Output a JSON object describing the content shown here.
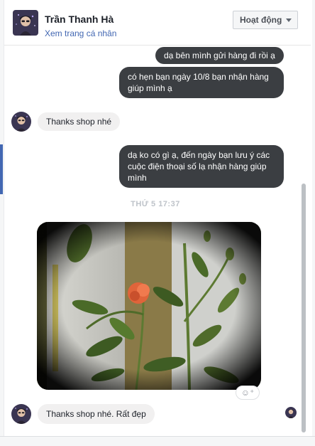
{
  "header": {
    "name": "Trần Thanh Hà",
    "profile_link": "Xem trang cá nhân",
    "activity_label": "Hoạt động",
    "avatar_icon": "avatar-icon"
  },
  "messages": [
    {
      "direction": "out",
      "text": "dạ bên mình gửi hàng đi rồi ạ"
    },
    {
      "direction": "out",
      "text": "có hẹn bạn ngày 10/8 bạn nhận hàng giúp mình ạ"
    },
    {
      "direction": "in",
      "text": "Thanks shop nhé"
    },
    {
      "direction": "out",
      "text": "dạ ko có gì ạ, đến ngày bạn lưu ý các cuộc điện thoại số lạ nhận hàng giúp mình"
    },
    {
      "direction": "in",
      "text": "Thanks shop nhé. Rất đẹp"
    }
  ],
  "timestamp": "THỨ 5 17:37",
  "photo": {
    "icon": "photo-icon"
  },
  "react_icon": "emoji-add-icon",
  "colors": {
    "outgoing_bubble": "#3b3e42",
    "incoming_bubble": "#f1f0f0",
    "link": "#4267b2",
    "timestamp": "#bec3c9"
  }
}
